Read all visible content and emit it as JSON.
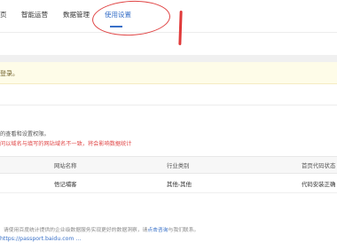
{
  "tabs": [
    {
      "label": "页"
    },
    {
      "label": "智能运营"
    },
    {
      "label": "数据管理"
    },
    {
      "label": "使用设置"
    }
  ],
  "notice": {
    "text": "登录。"
  },
  "description": {
    "text": "的查看和设置权限。",
    "warning": "问以域名与填写的网站域名不一致，将会影响数据统计"
  },
  "table": {
    "headers": [
      "网站名称",
      "行业类别",
      "首页代码状态"
    ],
    "rows": [
      {
        "name": "悟记埔客",
        "industry": "其他-其他",
        "status": "代码安装正确"
      }
    ]
  },
  "footer": {
    "note_prefix": "请使用百度统计提供的企业级数据服务实现更好的数据洞察，请",
    "note_link": "点击咨询",
    "note_suffix": "与我们联系。",
    "url": "https://passport.baidu.com ..."
  },
  "colors": {
    "accent": "#3870c8",
    "warning": "#e04848",
    "annotation": "#e04545"
  }
}
